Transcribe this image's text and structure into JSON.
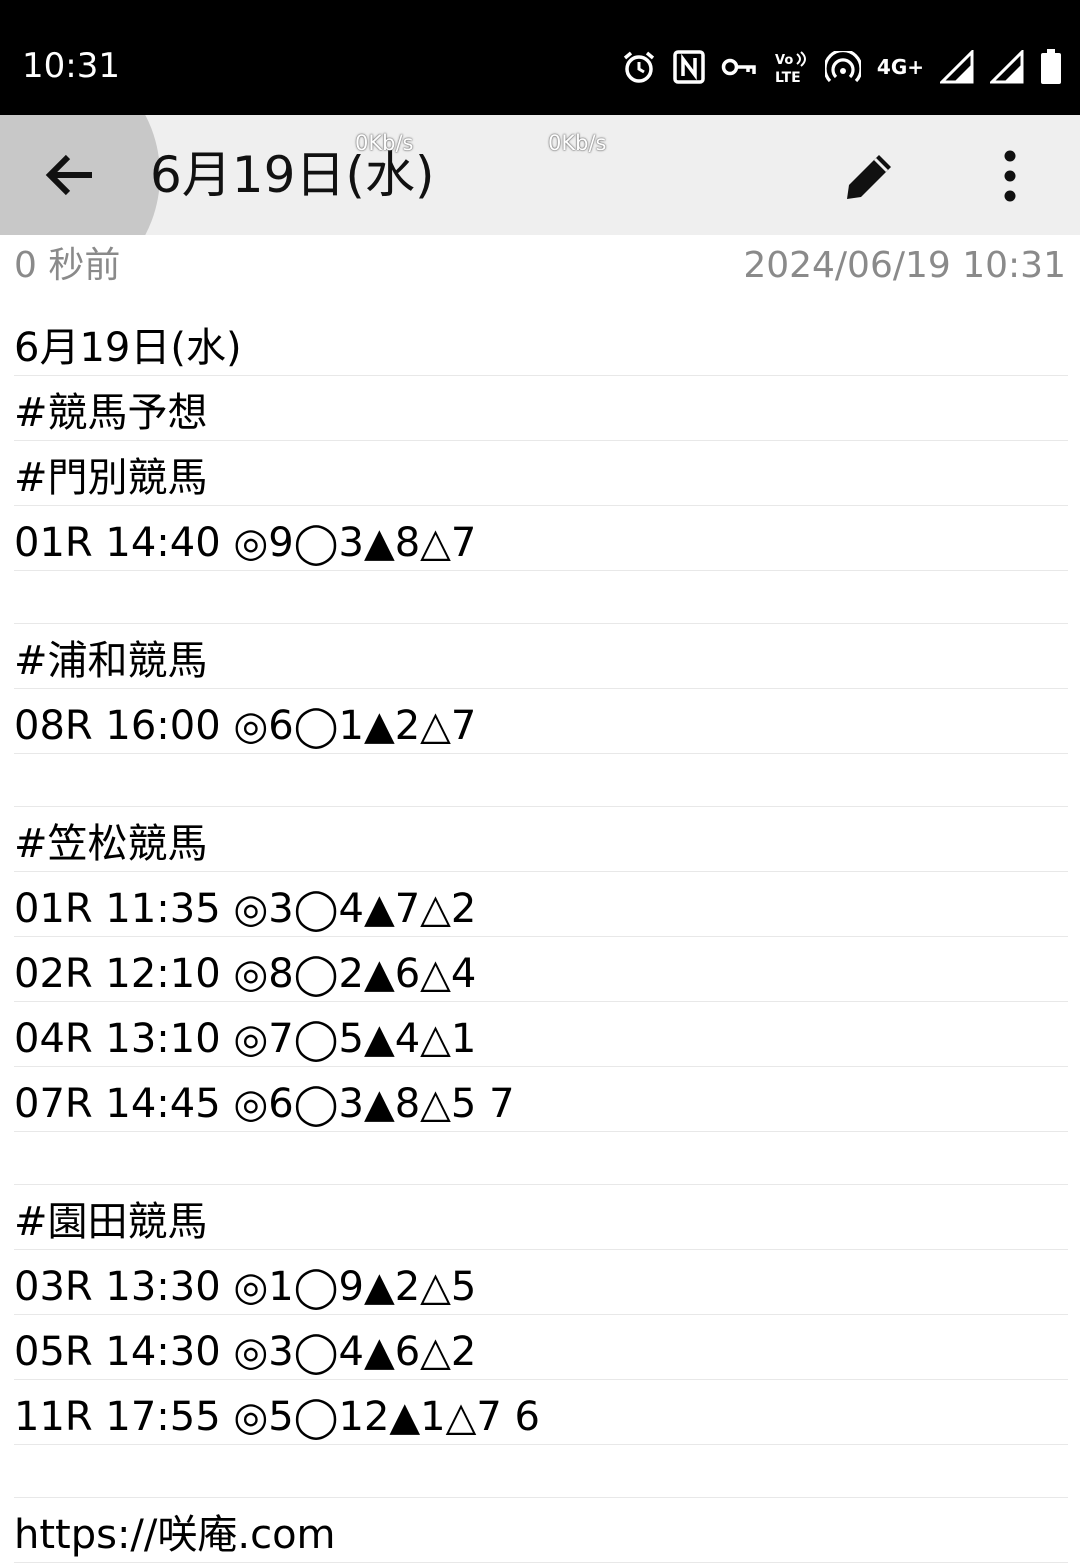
{
  "status_bar": {
    "time": "10:31",
    "network": "4G+",
    "icons": [
      "alarm-icon",
      "nfc-icon",
      "vpn-key-icon",
      "volte-icon",
      "hotspot-icon",
      "signal-icon",
      "signal-icon",
      "battery-icon"
    ]
  },
  "app_bar": {
    "title": "6月19日(水)",
    "speed_left": "0Kb/s",
    "speed_right": "0Kb/s",
    "back_icon": "arrow-back-icon",
    "edit_icon": "pencil-icon",
    "more_icon": "more-vert-icon"
  },
  "meta": {
    "relative_time": "0 秒前",
    "timestamp": "2024/06/19 10:31"
  },
  "note": {
    "lines": [
      "6月19日(水)",
      "#競馬予想",
      "#門別競馬",
      "01R 14:40 ◎9◯3▲8△7",
      "",
      "#浦和競馬",
      "08R 16:00 ◎6◯1▲2△7",
      "",
      "#笠松競馬",
      "01R 11:35 ◎3◯4▲7△2",
      "02R 12:10 ◎8◯2▲6△4",
      "04R 13:10 ◎7◯5▲4△1",
      "07R 14:45 ◎6◯3▲8△5 7",
      "",
      "#園田競馬",
      "03R 13:30 ◎1◯9▲2△5",
      "05R 14:30 ◎3◯4▲6△2",
      "11R 17:55 ◎5◯12▲1△7 6",
      "",
      "https://咲庵.com"
    ]
  }
}
